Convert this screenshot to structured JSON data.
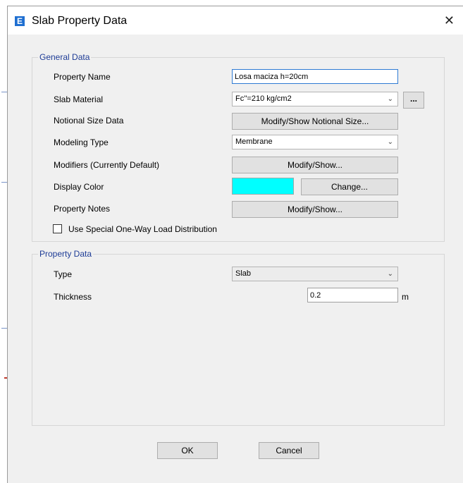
{
  "window": {
    "title": "Slab Property Data",
    "app_icon_letter": "E",
    "close_glyph": "✕"
  },
  "general": {
    "legend": "General Data",
    "property_name_label": "Property Name",
    "property_name_value": "Losa maciza h=20cm",
    "slab_material_label": "Slab Material",
    "slab_material_value": "Fc''=210 kg/cm2",
    "material_browse_label": "...",
    "notional_label": "Notional Size Data",
    "notional_button": "Modify/Show Notional Size...",
    "modeling_type_label": "Modeling Type",
    "modeling_type_value": "Membrane",
    "modifiers_label": "Modifiers (Currently Default)",
    "modifiers_button": "Modify/Show...",
    "display_color_label": "Display Color",
    "display_color_value": "#00ffff",
    "change_button": "Change...",
    "notes_label": "Property Notes",
    "notes_button": "Modify/Show...",
    "one_way_label": "Use Special One-Way Load Distribution",
    "one_way_checked": false
  },
  "property": {
    "legend": "Property Data",
    "type_label": "Type",
    "type_value": "Slab",
    "thickness_label": "Thickness",
    "thickness_value": "0.2",
    "thickness_unit": "m"
  },
  "footer": {
    "ok": "OK",
    "cancel": "Cancel"
  },
  "icons": {
    "dropdown": "chevron-down-icon",
    "close": "close-icon"
  },
  "colors": {
    "accent": "#1f6fd1",
    "group_label": "#1e3c96",
    "focus_border": "#2f7bd4"
  }
}
